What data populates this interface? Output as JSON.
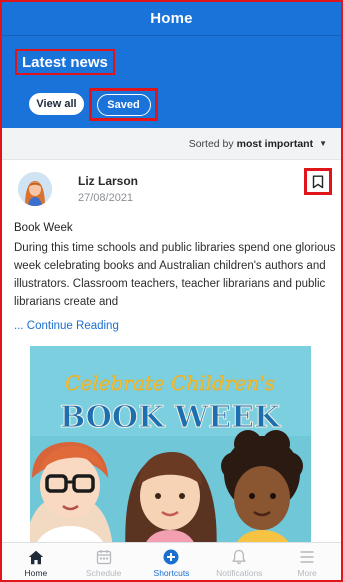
{
  "header": {
    "title": "Home"
  },
  "hero": {
    "section_title": "Latest news",
    "filters": {
      "view_all": "View all",
      "saved": "Saved"
    }
  },
  "sort": {
    "prefix": "Sorted by",
    "value": "most important",
    "caret": "▼"
  },
  "post": {
    "author": "Liz Larson",
    "date": "27/08/2021",
    "title": "Book Week",
    "body": "During this time schools and public libraries spend one glorious week celebrating books and Australian children's authors and illustrators. Classroom teachers, teacher librarians and public librarians create and",
    "read_more": "... Continue Reading",
    "image": {
      "line1": "Celebrate Children's",
      "line2": "BOOK WEEK"
    }
  },
  "tabs": [
    {
      "label": "Home",
      "icon": "home-icon",
      "state": "active"
    },
    {
      "label": "Schedule",
      "icon": "calendar-icon",
      "state": "inactive"
    },
    {
      "label": "Shortcuts",
      "icon": "plus-circle-icon",
      "state": "highlight"
    },
    {
      "label": "Notifications",
      "icon": "bell-icon",
      "state": "inactive"
    },
    {
      "label": "More",
      "icon": "menu-icon",
      "state": "inactive"
    }
  ],
  "colors": {
    "primary_blue": "#1a73d9",
    "highlight_red": "#e0141b",
    "link_blue": "#1a6fd0",
    "banner_teal": "#6fc7d8"
  }
}
